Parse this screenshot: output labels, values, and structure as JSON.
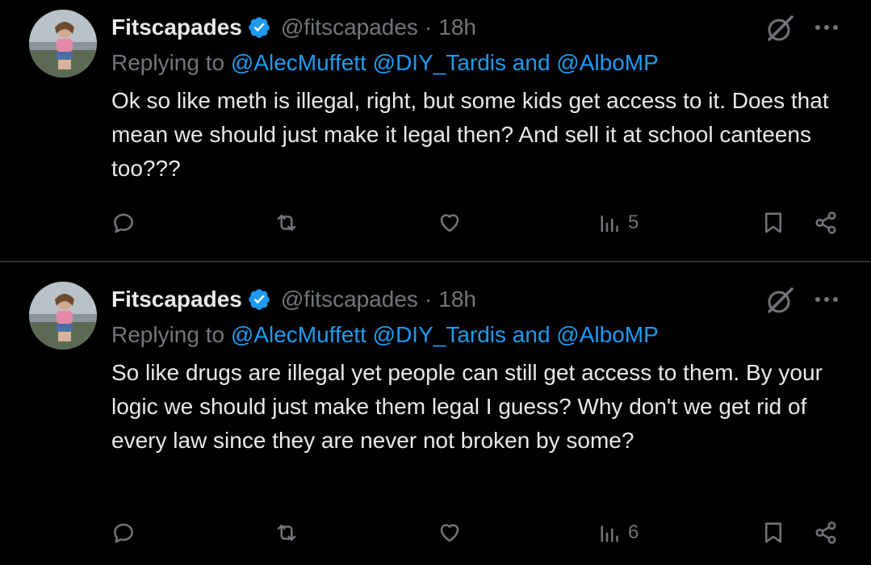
{
  "tweets": [
    {
      "author": "Fitscapades",
      "handle": "@fitscapades",
      "separator": "·",
      "time": "18h",
      "replying_prefix": "Replying to",
      "mention_1": "@AlecMuffett",
      "mention_2": "@DIY_Tardis",
      "and_word": "and",
      "mention_3": "@AlboMP",
      "text": "Ok so like meth is illegal, right, but some kids get access to it. Does that mean we should just make it legal then? And sell it at school canteens too???",
      "views": "5"
    },
    {
      "author": "Fitscapades",
      "handle": "@fitscapades",
      "separator": "·",
      "time": "18h",
      "replying_prefix": "Replying to",
      "mention_1": "@AlecMuffett",
      "mention_2": "@DIY_Tardis",
      "and_word": "and",
      "mention_3": "@AlboMP",
      "text": "So like drugs are illegal yet people can still get access to them. By your logic we should just make them legal I guess? Why don't we get rid of every law since they are never not broken by some?",
      "views": "6"
    }
  ],
  "colors": {
    "background": "#000000",
    "text": "#e7e9ea",
    "muted": "#71767b",
    "link": "#1d9bf0",
    "divider": "#2f3336"
  },
  "icons": [
    "verified-badge-icon",
    "grok-icon",
    "more-icon",
    "reply-icon",
    "retweet-icon",
    "like-icon",
    "views-icon",
    "bookmark-icon",
    "share-icon"
  ]
}
